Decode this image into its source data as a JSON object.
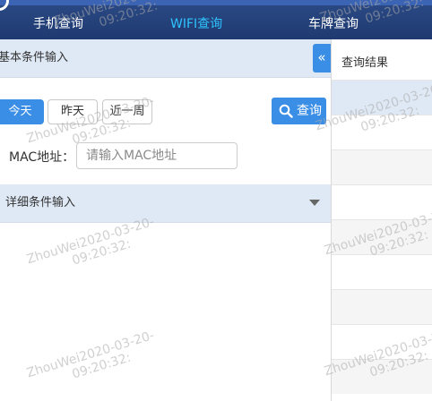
{
  "nav": {
    "tabs": [
      "手机查询",
      "WIFI查询",
      "车牌查询"
    ],
    "active_index": 1
  },
  "left": {
    "basic_title": "基本条件输入",
    "collapse_glyph": "«",
    "date_buttons": [
      "今天",
      "昨天",
      "近一周"
    ],
    "query_label": "查询",
    "mac_label": "MAC地址：",
    "mac_placeholder": "请输入MAC地址",
    "mac_value": "",
    "detail_title": "详细条件输入"
  },
  "right": {
    "title": "查询结果"
  },
  "watermark": {
    "line1": "ZhouWei2020-03-20-",
    "line2": "09:20:32:"
  },
  "colors": {
    "nav_bg": "#1f3a70",
    "active_tab": "#2ec4ff",
    "primary": "#3a8ee6",
    "section_bg": "#dfe9f5"
  },
  "icons": {
    "query": "search-icon",
    "collapse": "double-chevron-left-icon",
    "detail_toggle": "caret-down-icon",
    "logo": "logo-ring-icon"
  }
}
